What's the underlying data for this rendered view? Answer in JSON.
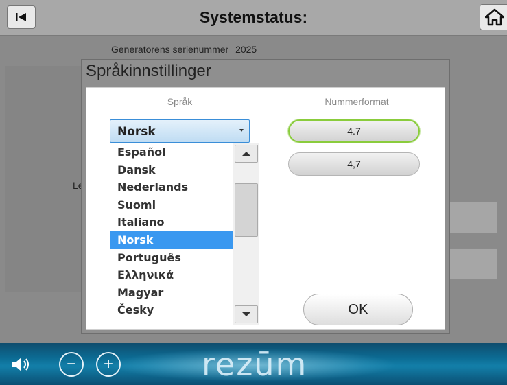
{
  "header": {
    "title": "Systemstatus:",
    "back_icon": "back-to-start-icon",
    "home_icon": "home-icon"
  },
  "background": {
    "serial_label": "Generatorens serienummer",
    "serial_value": "2025",
    "partial_label": "Le"
  },
  "dialog": {
    "title": "Språkinnstillinger",
    "language_label": "Språk",
    "number_format_label": "Nummerformat",
    "selected_language": "Norsk",
    "languages": [
      "Español",
      "Dansk",
      "Nederlands",
      "Suomi",
      "Italiano",
      "Norsk",
      "Português",
      "Ελληνικά",
      "Magyar",
      "Česky"
    ],
    "selected_index": 5,
    "number_formats": [
      "4.7",
      "4,7"
    ],
    "selected_format": "4.7",
    "ok_label": "OK"
  },
  "footer": {
    "brand": "rezūm",
    "speaker_icon": "speaker-icon",
    "minus_label": "−",
    "plus_label": "+"
  },
  "colors": {
    "selection": "#3a98f0",
    "format_highlight": "#8acc3c"
  }
}
